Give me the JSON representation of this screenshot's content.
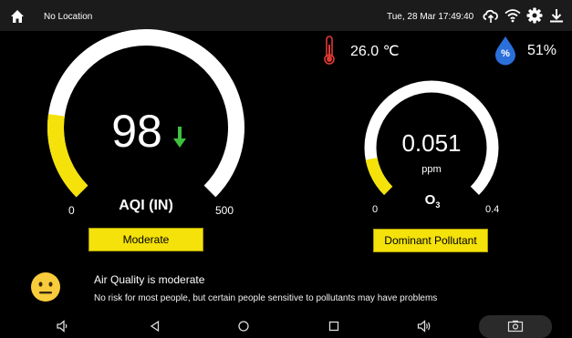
{
  "status_bar": {
    "location": "No Location",
    "datetime": "Tue, 28 Mar  17:49:40",
    "icons": [
      "home-icon",
      "cloud-sync-icon",
      "wifi-icon",
      "settings-gear-icon",
      "download-icon"
    ]
  },
  "climate": {
    "temperature": "26.0 ℃",
    "humidity_symbol": "%",
    "humidity": "51%"
  },
  "aqi_gauge": {
    "value": "98",
    "min_label": "0",
    "max_label": "500",
    "label": "AQI (IN)",
    "trend": "down",
    "level": 0.196,
    "fill_color": "#f4e20a",
    "track_color": "#ffffff",
    "trend_color": "#3fbf3f",
    "category_button": "Moderate"
  },
  "pollutant_gauge": {
    "value": "0.051",
    "unit": "ppm",
    "pollutant_main": "O",
    "pollutant_sub": "3",
    "min_label": "0",
    "max_label": "0.4",
    "level": 0.1275,
    "button": "Dominant Pollutant"
  },
  "advisory": {
    "face_icon": "neutral-face-icon",
    "title": "Air Quality is moderate",
    "message": "No risk for most people, but certain people sensitive to pollutants may have problems"
  },
  "nav_bar": {
    "icons": [
      "volume-down-icon",
      "back-icon",
      "home-circle-icon",
      "recents-square-icon",
      "volume-up-icon",
      "screenshot-icon"
    ]
  }
}
